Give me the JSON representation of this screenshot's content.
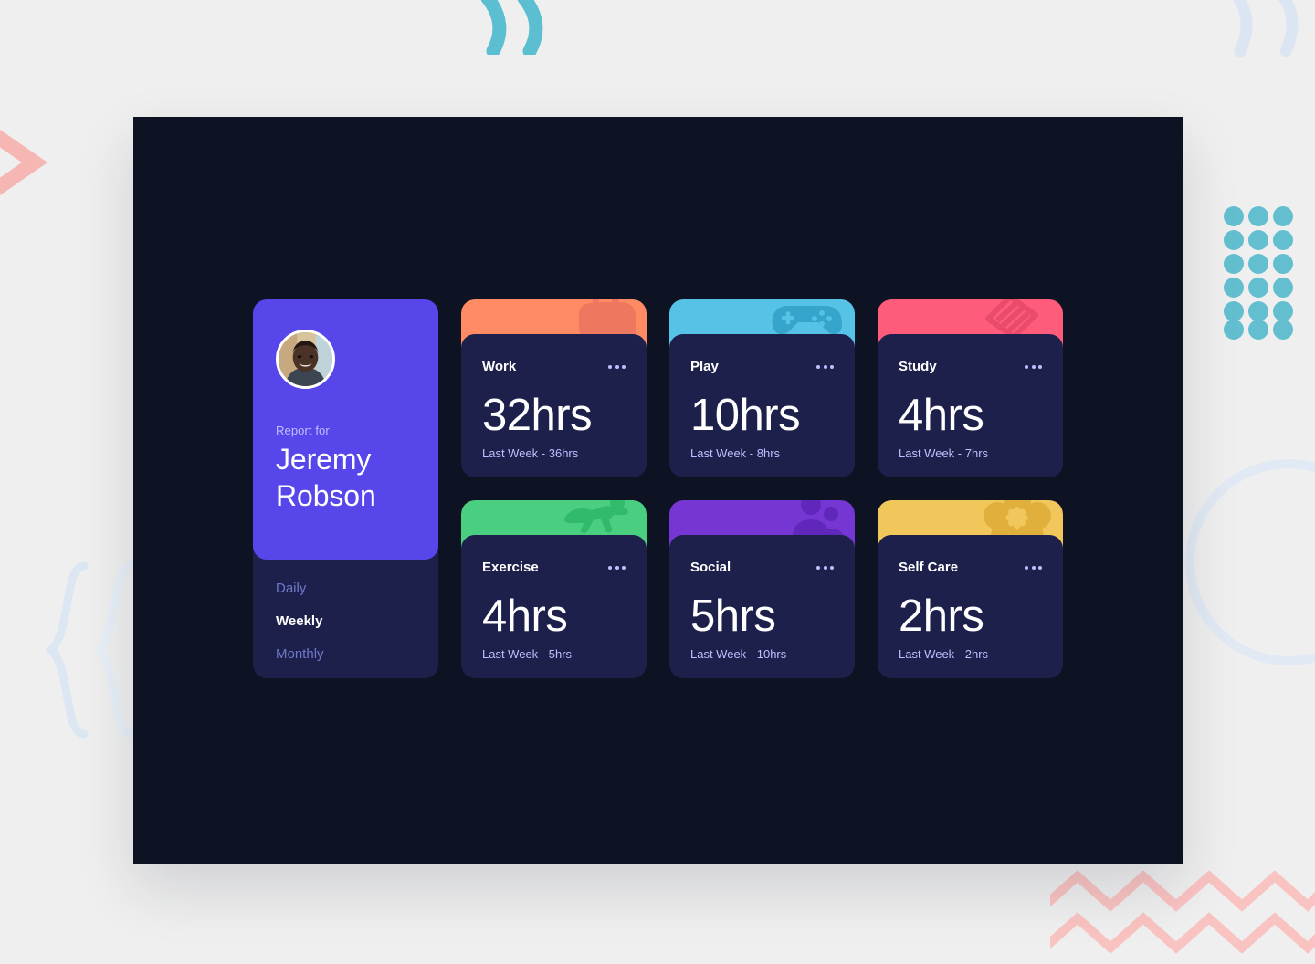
{
  "theme": {
    "page_background": "#EFEFEF",
    "window_background": "#0E1323",
    "card_background": "#1D204B",
    "card_hover": "#272C5A",
    "profile_accent": "#5747EA",
    "muted_text": "#BBC0FF",
    "nav_inactive": "#7078C9",
    "white": "#FFFFFF"
  },
  "profile": {
    "avatar_name": "avatar",
    "report_label": "Report for",
    "name_line_1": "Jeremy",
    "name_line_2": "Robson",
    "full_name": "Jeremy Robson",
    "nav": [
      {
        "label": "Daily",
        "active": false
      },
      {
        "label": "Weekly",
        "active": true
      },
      {
        "label": "Monthly",
        "active": false
      }
    ]
  },
  "timeframe_selected": "Weekly",
  "menu_icon": "ellipsis-icon",
  "cards": [
    {
      "title": "Work",
      "hours": "32hrs",
      "previous": "Last Week - 36hrs",
      "accent_color": "#FF8B64",
      "icon_name": "briefcase-icon",
      "icon_color": "#EC775F"
    },
    {
      "title": "Play",
      "hours": "10hrs",
      "previous": "Last Week - 8hrs",
      "accent_color": "#55C2E6",
      "icon_name": "game-controller-icon",
      "icon_color": "#34A3C9"
    },
    {
      "title": "Study",
      "hours": "4hrs",
      "previous": "Last Week - 7hrs",
      "accent_color": "#FF5C7C",
      "icon_name": "book-icon",
      "icon_color": "#EA4A6A"
    },
    {
      "title": "Exercise",
      "hours": "4hrs",
      "previous": "Last Week - 5hrs",
      "accent_color": "#4ACF81",
      "icon_name": "running-person-icon",
      "icon_color": "#30B96A"
    },
    {
      "title": "Social",
      "hours": "5hrs",
      "previous": "Last Week - 10hrs",
      "accent_color": "#7536D3",
      "icon_name": "people-icon",
      "icon_color": "#5E27B8"
    },
    {
      "title": "Self Care",
      "hours": "2hrs",
      "previous": "Last Week - 2hrs",
      "accent_color": "#F1C65B",
      "icon_name": "flower-icon",
      "icon_color": "#E0AE3A"
    }
  ],
  "decorations": {
    "quote_teal": {
      "name": "quotation-marks-teal",
      "color": "#5BBFD1"
    },
    "quote_blue": {
      "name": "quotation-marks-blue",
      "color": "#DCE6F2"
    },
    "dots_grid": {
      "name": "dot-grid",
      "color": "#63BFCF",
      "columns": 3,
      "rows": 6
    },
    "chevron": {
      "name": "chevron-shape",
      "color": "#F6B6B4"
    },
    "brace": {
      "name": "curly-braces",
      "color": "#DDE7F3"
    },
    "circle": {
      "name": "circle-outline",
      "color": "#E1EAF4"
    },
    "zigzag": {
      "name": "zigzag-lines",
      "color": "#F9C3C1",
      "rows": 2
    }
  }
}
